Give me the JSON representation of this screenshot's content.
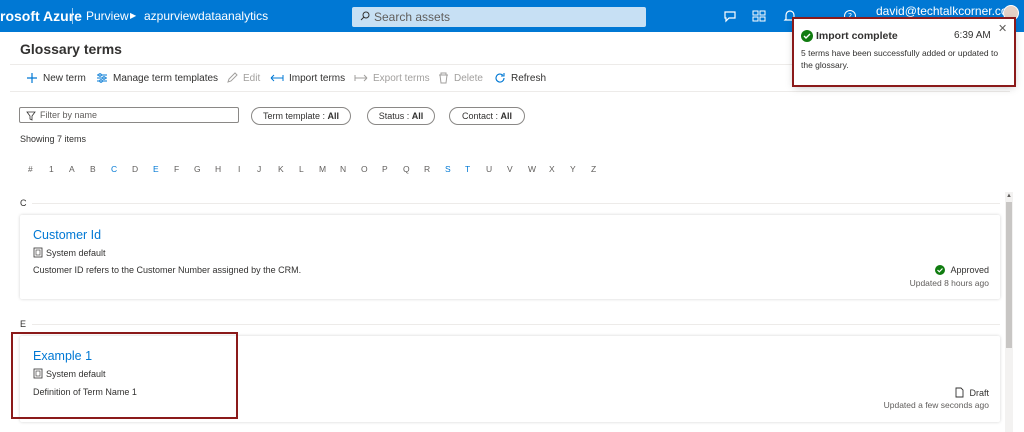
{
  "topbar": {
    "brand": "rosoft Azure",
    "service": "Purview",
    "account": "azpurviewdataanalytics",
    "search_placeholder": "Search assets",
    "user_email": "david@techtalkcorner.com",
    "bg_color": "#0078d4",
    "icons": [
      "feedback-icon",
      "directory-icon",
      "notifications-icon",
      "help-icon"
    ]
  },
  "page": {
    "title": "Glossary terms"
  },
  "commands": {
    "new_term": "New term",
    "manage_templates": "Manage term templates",
    "edit": "Edit",
    "import_terms": "Import terms",
    "export_terms": "Export terms",
    "delete": "Delete",
    "refresh": "Refresh"
  },
  "filters": {
    "filter_placeholder": "Filter by name",
    "term_template_label": "Term template :",
    "term_template_value": "All",
    "status_label": "Status :",
    "status_value": "All",
    "contact_label": "Contact :",
    "contact_value": "All",
    "showing": "Showing 7 items"
  },
  "alphabet": {
    "letters": [
      "#",
      "1",
      "A",
      "B",
      "C",
      "D",
      "E",
      "F",
      "G",
      "H",
      "I",
      "J",
      "K",
      "L",
      "M",
      "N",
      "O",
      "P",
      "Q",
      "R",
      "S",
      "T",
      "U",
      "V",
      "W",
      "X",
      "Y",
      "Z"
    ],
    "active": [
      "C",
      "E",
      "S",
      "T"
    ]
  },
  "groups": [
    {
      "letter": "C",
      "term": {
        "name": "Customer Id",
        "template": "System default",
        "definition": "Customer ID refers to the Customer Number assigned by the CRM.",
        "status": "Approved",
        "updated": "Updated 8 hours ago"
      }
    },
    {
      "letter": "E",
      "term": {
        "name": "Example 1",
        "template": "System default",
        "definition": "Definition of Term Name 1",
        "status": "Draft",
        "updated": "Updated a few seconds ago"
      }
    }
  ],
  "toast": {
    "title": "Import complete",
    "time": "6:39 AM",
    "message": "5 terms have been successfully added or updated to the glossary."
  },
  "colors": {
    "accent": "#0078d4",
    "success": "#107c10",
    "highlight": "#8b1a1a"
  }
}
